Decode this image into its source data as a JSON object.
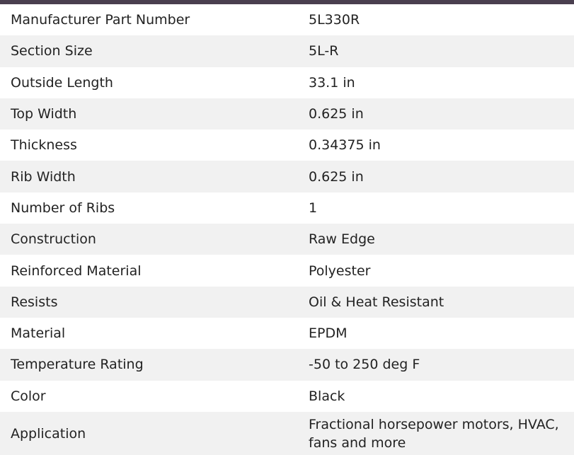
{
  "colors": {
    "top_bar": "#4a3f4f",
    "row_alt": "#f1f1f1",
    "text": "#222222"
  },
  "specs": [
    {
      "name": "Manufacturer Part Number",
      "value": "5L330R"
    },
    {
      "name": "Section Size",
      "value": "5L-R"
    },
    {
      "name": "Outside Length",
      "value": "33.1 in"
    },
    {
      "name": "Top Width",
      "value": "0.625 in"
    },
    {
      "name": "Thickness",
      "value": "0.34375 in"
    },
    {
      "name": "Rib Width",
      "value": "0.625 in"
    },
    {
      "name": "Number of Ribs",
      "value": "1"
    },
    {
      "name": "Construction",
      "value": "Raw Edge"
    },
    {
      "name": "Reinforced Material",
      "value": "Polyester"
    },
    {
      "name": "Resists",
      "value": "Oil & Heat Resistant"
    },
    {
      "name": "Material",
      "value": "EPDM"
    },
    {
      "name": "Temperature Rating",
      "value": "-50 to 250 deg F"
    },
    {
      "name": "Color",
      "value": "Black"
    },
    {
      "name": "Application",
      "value": "Fractional horsepower motors, HVAC, fans and more"
    }
  ]
}
